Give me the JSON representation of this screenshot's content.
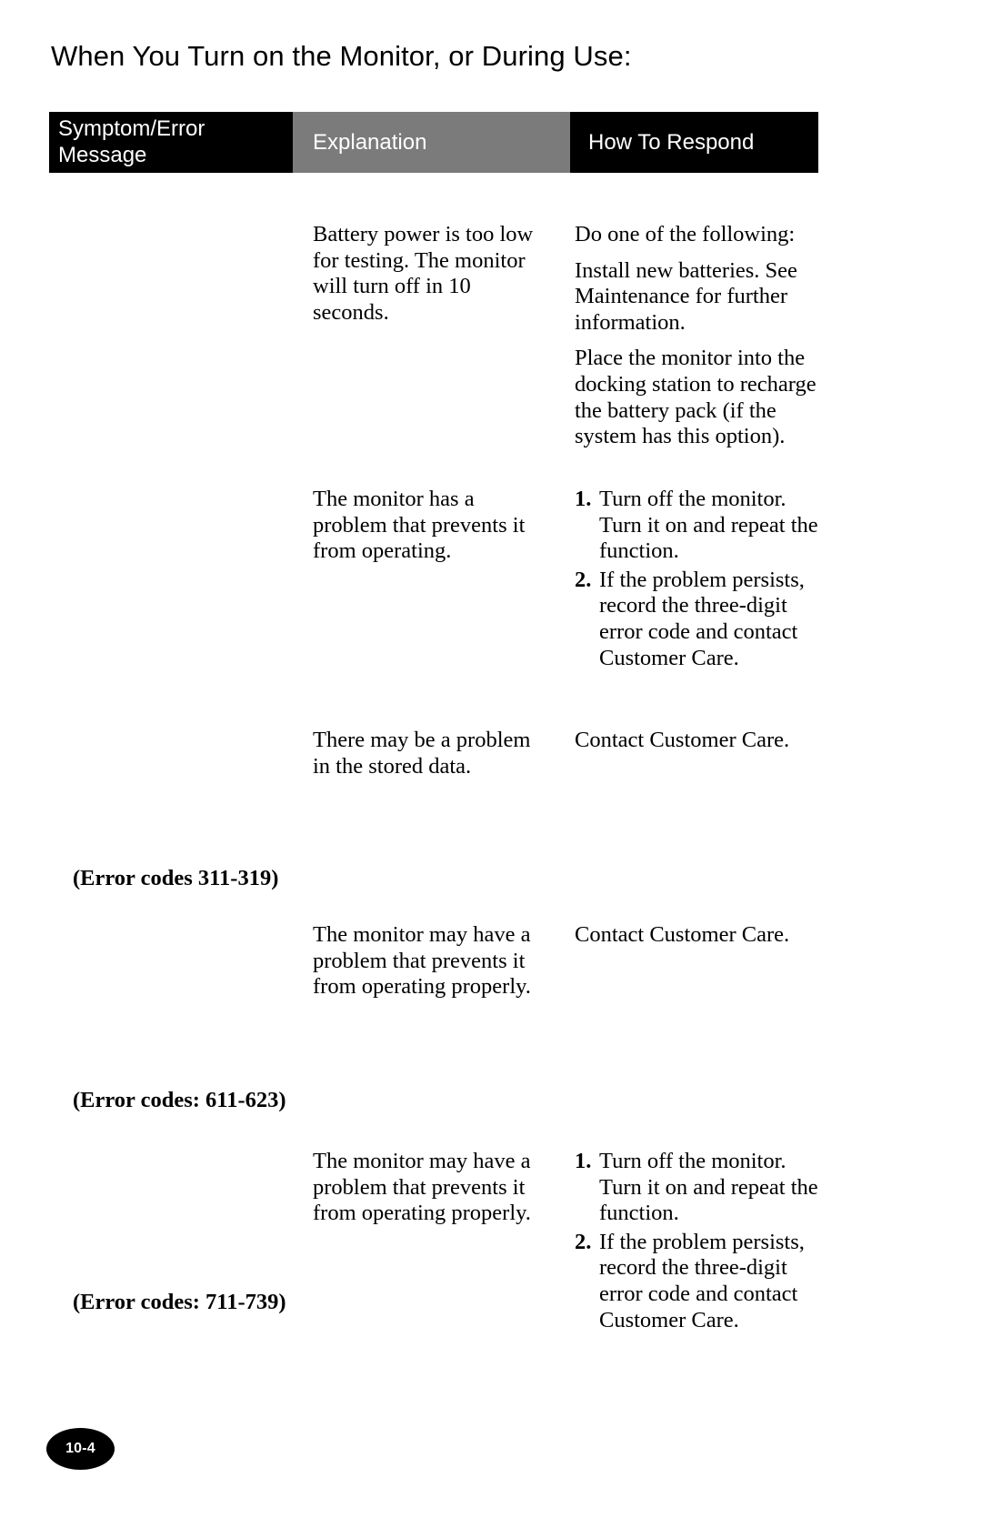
{
  "page": {
    "title": "When You Turn on the Monitor, or During Use:",
    "page_number": "10-4"
  },
  "table": {
    "headers": {
      "symptom": "Symptom/Error Message",
      "symptom_line1": "Symptom/Error",
      "symptom_line2": "Message",
      "explanation": "Explanation",
      "respond": "How To Respond"
    },
    "header_colors": {
      "symptom_bg": "#000000",
      "explanation_bg": "#7b7b7b",
      "respond_bg": "#000000",
      "header_text": "#ffffff"
    },
    "rows": [
      {
        "symptom": "",
        "explanation": [
          "Battery power is too low for testing. The monitor will turn off in 10 seconds."
        ],
        "respond_paragraphs": [
          "Do one of the following:",
          "Install new batteries. See Maintenance for further information.",
          "Place the monitor into the docking station to recharge the battery pack (if the system has this option)."
        ],
        "respond_list": []
      },
      {
        "symptom": "",
        "explanation": [
          "The monitor has a problem that prevents it from operating."
        ],
        "respond_paragraphs": [],
        "respond_list": [
          {
            "marker": "1.",
            "text": "Turn off the monitor. Turn it on and repeat the function."
          },
          {
            "marker": "2.",
            "text": "If the problem persists, record the three-digit error code and contact Customer Care."
          }
        ]
      },
      {
        "symptom": "(Error codes 311-319)",
        "explanation": [
          "There may be a problem in the stored data."
        ],
        "respond_paragraphs": [
          "Contact Customer Care."
        ],
        "respond_list": []
      },
      {
        "symptom": "(Error codes: 611-623)",
        "explanation": [
          "The monitor may have a problem that prevents it from operating properly."
        ],
        "respond_paragraphs": [
          "Contact Customer Care."
        ],
        "respond_list": []
      },
      {
        "symptom": "(Error codes: 711-739)",
        "explanation": [
          "The monitor may have a problem that prevents it from operating properly."
        ],
        "respond_paragraphs": [],
        "respond_list": [
          {
            "marker": "1.",
            "text": "Turn off the monitor. Turn it on and repeat the function."
          },
          {
            "marker": "2.",
            "text": "If the problem persists, record the three-digit error code and contact Customer Care."
          }
        ]
      }
    ]
  }
}
